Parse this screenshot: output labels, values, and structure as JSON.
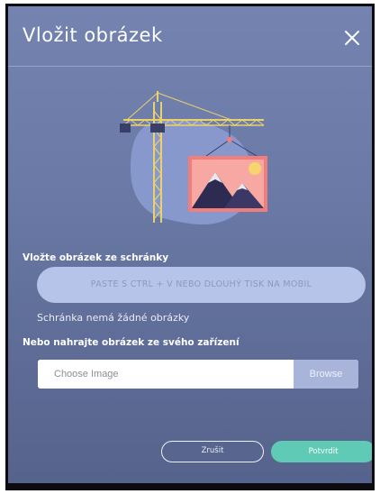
{
  "dialog": {
    "title": "Vložit obrázek",
    "close_icon": "close-icon"
  },
  "illustration": {
    "icon": "crane-with-image-illustration",
    "colors": {
      "blob": "#8b9bd0",
      "crane": "#e9d26a",
      "frame": "#f07f7b",
      "sun": "#f6d56e",
      "mountain": "#2e2b52"
    }
  },
  "clipboard": {
    "label": "Vložte obrázek ze schránky",
    "paste_hint": "PASTE S CTRL + V NEBO DLOUHÝ TISK NA MOBIL",
    "empty_note": "Schránka nemá žádné obrázky"
  },
  "upload": {
    "label": "Nebo nahrajte obrázek ze svého zařízení",
    "placeholder": "Choose Image",
    "browse_label": "Browse"
  },
  "actions": {
    "cancel_label": "Zrušit",
    "confirm_label": "Potvrdit"
  },
  "colors": {
    "accent": "#5fcbb6",
    "background_top": "#7483b0",
    "background_bottom": "#56638c",
    "paste_pill": "#b7c4ea"
  }
}
